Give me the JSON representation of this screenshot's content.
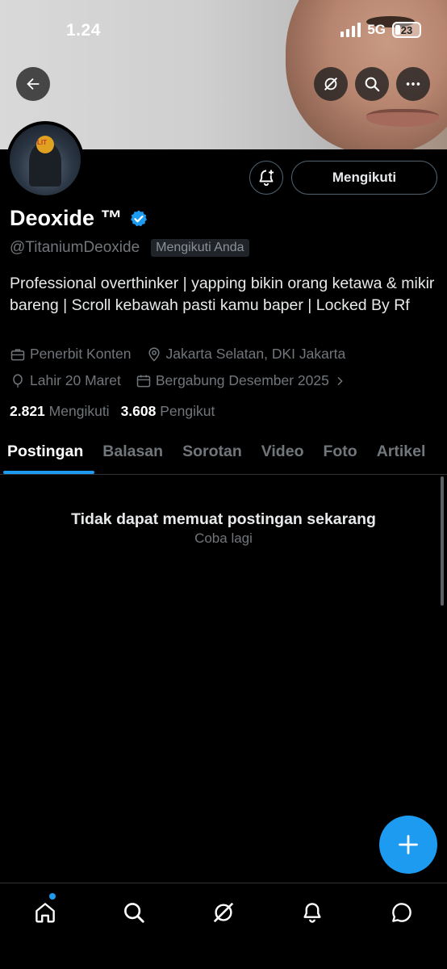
{
  "status_bar": {
    "time": "1.24",
    "network": "5G",
    "battery": "23"
  },
  "profile": {
    "name": "Deoxide ™",
    "handle": "@TitaniumDeoxide",
    "follows_you": "Mengikuti Anda",
    "bio": "Professional overthinker | yapping bikin orang ketawa & mikir bareng | Scroll kebawah pasti kamu baper | Locked By Rf",
    "category": "Penerbit Konten",
    "location": "Jakarta Selatan, DKI Jakarta",
    "birthday": "Lahir 20 Maret",
    "joined": "Bergabung Desember 2025",
    "following_count": "2.821",
    "following_label": "Mengikuti",
    "followers_count": "3.608",
    "followers_label": "Pengikut",
    "verified": true,
    "verified_color": "#1d9bf0"
  },
  "actions": {
    "follow_label": "Mengikuti"
  },
  "tabs": [
    {
      "label": "Postingan",
      "active": true
    },
    {
      "label": "Balasan"
    },
    {
      "label": "Sorotan"
    },
    {
      "label": "Video"
    },
    {
      "label": "Foto"
    },
    {
      "label": "Artikel"
    }
  ],
  "feed": {
    "error_title": "Tidak dapat memuat postingan sekarang",
    "retry_label": "Coba lagi"
  },
  "bottom_nav": [
    "home-icon",
    "search-icon",
    "grok-icon",
    "bell-icon",
    "messages-icon"
  ],
  "colors": {
    "accent": "#1d9bf0",
    "background": "#000000",
    "muted": "#71767b"
  }
}
